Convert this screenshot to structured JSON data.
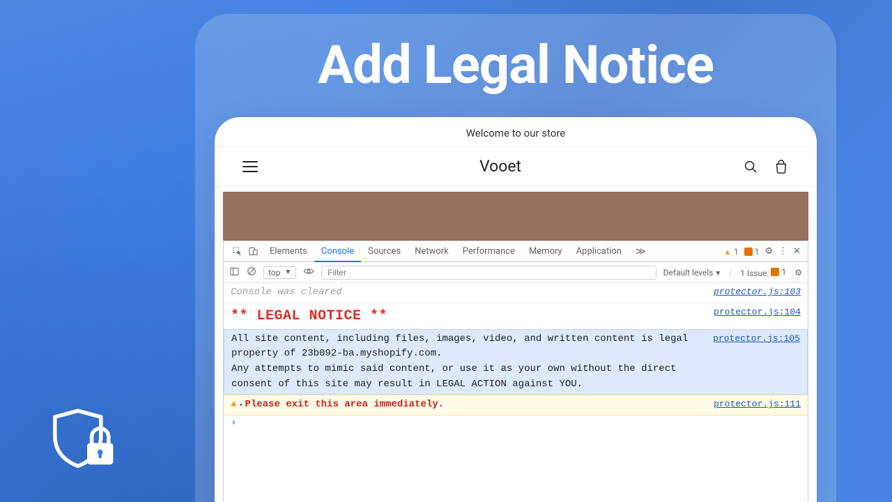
{
  "hero": {
    "title": "Add Legal Notice"
  },
  "store": {
    "announcement": "Welcome to our store",
    "name": "Vooet"
  },
  "devtools": {
    "tabs": {
      "elements": "Elements",
      "console": "Console",
      "sources": "Sources",
      "network": "Network",
      "performance": "Performance",
      "memory": "Memory",
      "application": "Application"
    },
    "warn_count": "1",
    "issue_count": "1",
    "toolbar": {
      "context": "top",
      "filter_placeholder": "Filter",
      "levels": "Default levels",
      "issues_label": "1 Issue:",
      "issues_count": "1"
    },
    "log": {
      "cleared": "Console was cleared",
      "cleared_src": "protector.js:103",
      "legal_title": "** LEGAL NOTICE **",
      "legal_title_src": "protector.js:104",
      "body_src": "protector.js:105",
      "body": "All site content, including files, images, video, and written content is legal property of 23b092-ba.myshopify.com.\nAny attempts to mimic said content, or use it as your own without the direct consent of this site may result in LEGAL ACTION against YOU.",
      "warn": "Please exit this area immediately.",
      "warn_src": "protector.js:111"
    }
  }
}
